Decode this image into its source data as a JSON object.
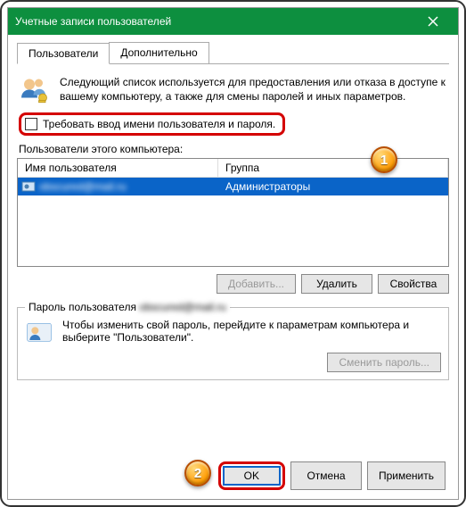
{
  "window": {
    "title": "Учетные записи пользователей"
  },
  "tabs": {
    "users": "Пользователи",
    "advanced": "Дополнительно"
  },
  "description": "Следующий список используется для предоставления или отказа в доступе к вашему компьютеру, а также для смены паролей и иных параметров.",
  "checkbox": {
    "label": "Требовать ввод имени пользователя и пароля."
  },
  "userlist": {
    "label": "Пользователи этого компьютера:",
    "columns": {
      "user": "Имя пользователя",
      "group": "Группа"
    },
    "rows": [
      {
        "user": "obscured@mail.ru",
        "group": "Администраторы"
      }
    ]
  },
  "buttons": {
    "add": "Добавить...",
    "remove": "Удалить",
    "properties": "Свойства"
  },
  "password_group": {
    "legend_prefix": "Пароль пользователя ",
    "legend_user": "obscured@mail.ru",
    "text": "Чтобы изменить свой пароль, перейдите к параметрам компьютера и выберите \"Пользователи\".",
    "change": "Сменить пароль..."
  },
  "dialog_buttons": {
    "ok": "OK",
    "cancel": "Отмена",
    "apply": "Применить"
  },
  "badges": {
    "one": "1",
    "two": "2"
  }
}
